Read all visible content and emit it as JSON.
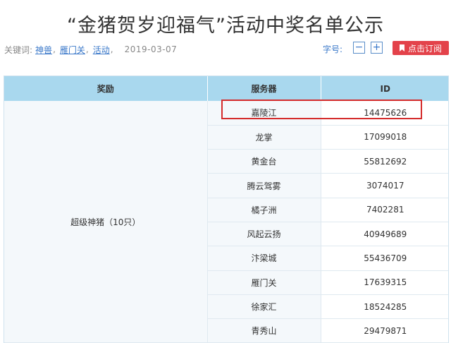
{
  "title": "“金猪贺岁迎福气”活动中奖名单公示",
  "meta": {
    "keywords_label": "关键词:",
    "keywords": [
      "神兽",
      "雁门关",
      "活动"
    ],
    "date": "2019-03-07"
  },
  "font_size": {
    "label": "字号:",
    "decrease": "−",
    "increase": "+"
  },
  "subscribe_label": "点击订阅",
  "table": {
    "headers": [
      "奖励",
      "服务器",
      "ID"
    ],
    "prize": "超级神猪（10只）",
    "rows": [
      {
        "server": "嘉陵江",
        "id": "14475626"
      },
      {
        "server": "龙掌",
        "id": "17099018"
      },
      {
        "server": "黄金台",
        "id": "55812692"
      },
      {
        "server": "腾云驾雾",
        "id": "3074017"
      },
      {
        "server": "橘子洲",
        "id": "7402281"
      },
      {
        "server": "风起云扬",
        "id": "40949689"
      },
      {
        "server": "汴梁城",
        "id": "55436709"
      },
      {
        "server": "雁门关",
        "id": "17639315"
      },
      {
        "server": "徐家汇",
        "id": "18524285"
      },
      {
        "server": "青秀山",
        "id": "29479871"
      }
    ]
  },
  "colors": {
    "header_bg": "#a9d8ee",
    "link": "#3a78c9",
    "subscribe_bg": "#e3424a",
    "highlight": "#d42b2b"
  }
}
